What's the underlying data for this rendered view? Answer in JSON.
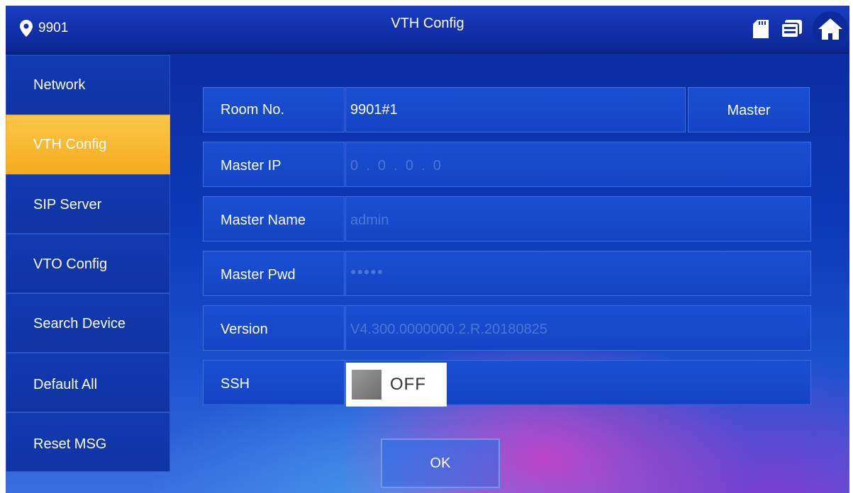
{
  "header": {
    "location": "9901",
    "title": "VTH Config",
    "icons": [
      "sd-card-icon",
      "message-icon",
      "home-icon"
    ]
  },
  "sidebar": {
    "items": [
      {
        "label": "Network",
        "active": false
      },
      {
        "label": "VTH Config",
        "active": true
      },
      {
        "label": "SIP Server",
        "active": false
      },
      {
        "label": "VTO Config",
        "active": false
      },
      {
        "label": "Search Device",
        "active": false
      },
      {
        "label": "Default All",
        "active": false
      },
      {
        "label": "Reset MSG",
        "active": false
      }
    ]
  },
  "form": {
    "room_no": {
      "label": "Room No.",
      "value": "9901#1",
      "button": "Master"
    },
    "master_ip": {
      "label": "Master IP",
      "value": "0  .  0  .  0  .  0"
    },
    "master_name": {
      "label": "Master Name",
      "value": "admin"
    },
    "master_pwd": {
      "label": "Master Pwd",
      "value": "●●●●●"
    },
    "version": {
      "label": "Version",
      "value": "V4.300.0000000.2.R.20180825"
    },
    "ssh": {
      "label": "SSH",
      "state": "OFF"
    }
  },
  "ok_button": "OK",
  "colors": {
    "active_tab": "#f5ab1d",
    "background": "#0d39b8",
    "cell": "#1444c4"
  }
}
